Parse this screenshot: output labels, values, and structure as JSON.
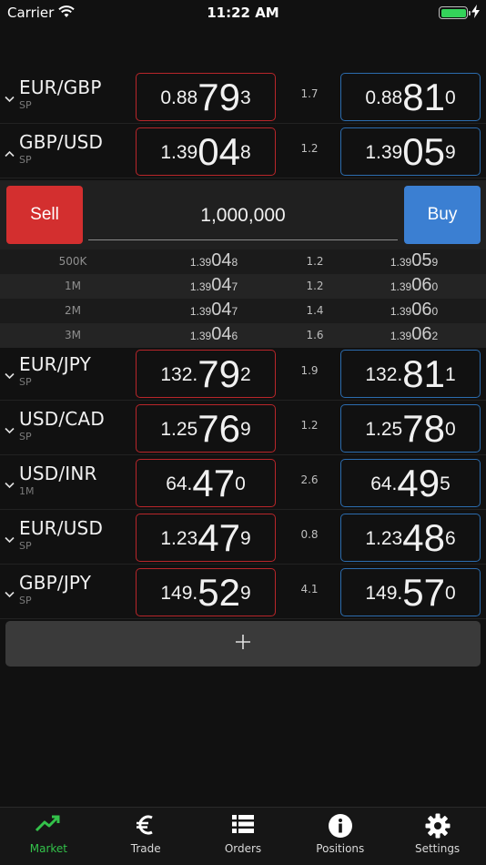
{
  "status": {
    "carrier": "Carrier",
    "time": "11:22 AM"
  },
  "colors": {
    "sell": "#d32f2f",
    "buy": "#3b7fd2",
    "sell_border": "#b8262a",
    "buy_border": "#2c6cae",
    "active_tab": "#33c24a",
    "background": "#111111"
  },
  "pairs": [
    {
      "name": "EUR/GBP",
      "sub": "SP",
      "expanded": false,
      "bid": {
        "small": "0.88",
        "big": "79",
        "pip": "3"
      },
      "spread": "1.7",
      "ask": {
        "small": "0.88",
        "big": "81",
        "pip": "0"
      }
    },
    {
      "name": "GBP/USD",
      "sub": "SP",
      "expanded": true,
      "bid": {
        "small": "1.39",
        "big": "04",
        "pip": "8"
      },
      "spread": "1.2",
      "ask": {
        "small": "1.39",
        "big": "05",
        "pip": "9"
      }
    },
    {
      "name": "EUR/JPY",
      "sub": "SP",
      "expanded": false,
      "bid": {
        "small": "132.",
        "big": "79",
        "pip": "2"
      },
      "spread": "1.9",
      "ask": {
        "small": "132.",
        "big": "81",
        "pip": "1"
      }
    },
    {
      "name": "USD/CAD",
      "sub": "SP",
      "expanded": false,
      "bid": {
        "small": "1.25",
        "big": "76",
        "pip": "9"
      },
      "spread": "1.2",
      "ask": {
        "small": "1.25",
        "big": "78",
        "pip": "0"
      }
    },
    {
      "name": "USD/INR",
      "sub": "1M",
      "expanded": false,
      "bid": {
        "small": "64.",
        "big": "47",
        "pip": "0"
      },
      "spread": "2.6",
      "ask": {
        "small": "64.",
        "big": "49",
        "pip": "5"
      }
    },
    {
      "name": "EUR/USD",
      "sub": "SP",
      "expanded": false,
      "bid": {
        "small": "1.23",
        "big": "47",
        "pip": "9"
      },
      "spread": "0.8",
      "ask": {
        "small": "1.23",
        "big": "48",
        "pip": "6"
      }
    },
    {
      "name": "GBP/JPY",
      "sub": "SP",
      "expanded": false,
      "bid": {
        "small": "149.",
        "big": "52",
        "pip": "9"
      },
      "spread": "4.1",
      "ask": {
        "small": "149.",
        "big": "57",
        "pip": "0"
      }
    }
  ],
  "trade": {
    "sell_label": "Sell",
    "buy_label": "Buy",
    "amount": "1,000,000"
  },
  "ladder": [
    {
      "size": "500K",
      "bid": {
        "small": "1.39",
        "big": "04",
        "pip": "8"
      },
      "spread": "1.2",
      "ask": {
        "small": "1.39",
        "big": "05",
        "pip": "9"
      }
    },
    {
      "size": "1M",
      "bid": {
        "small": "1.39",
        "big": "04",
        "pip": "7"
      },
      "spread": "1.2",
      "ask": {
        "small": "1.39",
        "big": "06",
        "pip": "0"
      }
    },
    {
      "size": "2M",
      "bid": {
        "small": "1.39",
        "big": "04",
        "pip": "7"
      },
      "spread": "1.4",
      "ask": {
        "small": "1.39",
        "big": "06",
        "pip": "0"
      }
    },
    {
      "size": "3M",
      "bid": {
        "small": "1.39",
        "big": "04",
        "pip": "6"
      },
      "spread": "1.6",
      "ask": {
        "small": "1.39",
        "big": "06",
        "pip": "2"
      }
    }
  ],
  "add_button": {
    "icon": "plus-icon"
  },
  "tabs": [
    {
      "label": "Market",
      "icon": "chart-trend-icon",
      "active": true
    },
    {
      "label": "Trade",
      "icon": "euro-icon",
      "active": false
    },
    {
      "label": "Orders",
      "icon": "list-icon",
      "active": false
    },
    {
      "label": "Positions",
      "icon": "info-icon",
      "active": false
    },
    {
      "label": "Settings",
      "icon": "gear-icon",
      "active": false
    }
  ]
}
